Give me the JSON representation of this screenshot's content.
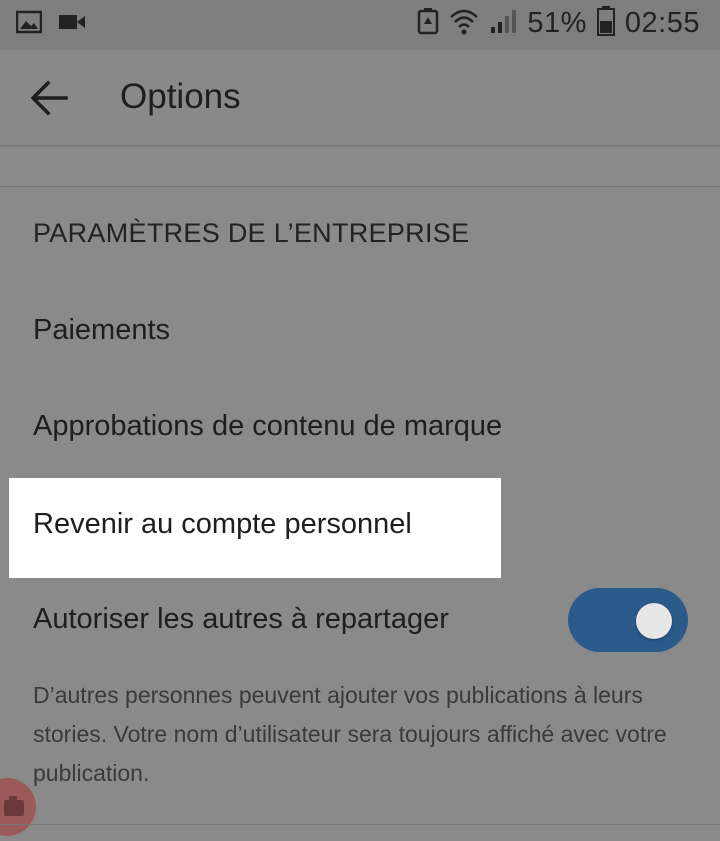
{
  "status_bar": {
    "battery_percent": "51%",
    "time": "02:55",
    "left_icons": [
      "image-icon",
      "video-icon"
    ],
    "right_icons": [
      "battery-saver-icon",
      "wifi-icon",
      "signal-icon",
      "battery-icon"
    ]
  },
  "header": {
    "back_icon": "arrow-left-icon",
    "title": "Options"
  },
  "section": {
    "title": "PARAMÈTRES DE L’ENTREPRISE",
    "items": [
      {
        "label": "Paiements"
      },
      {
        "label": "Approbations de contenu de marque"
      },
      {
        "label": "Revenir au compte personnel"
      }
    ],
    "toggle_row": {
      "label": "Autoriser les autres à repartager",
      "enabled": true,
      "description": "D’autres personnes peuvent ajouter vos publications à leurs stories. Votre nom d’utilisateur sera toujours affiché avec votre publication."
    }
  },
  "colors": {
    "overlay": "#8a8a8a",
    "highlight": "#ffffff",
    "toggle_on": "#2a5a8a"
  }
}
